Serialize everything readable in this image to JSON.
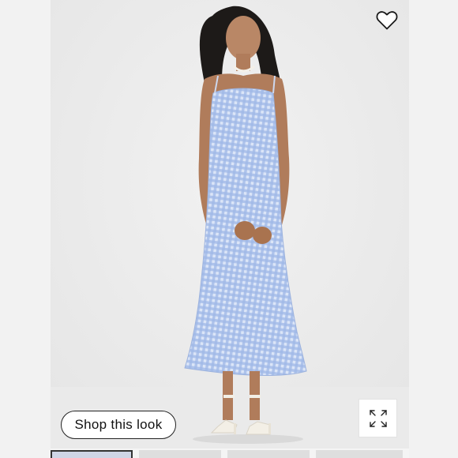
{
  "product": {
    "shop_look_label": "Shop this look"
  },
  "icons": {
    "favorite": "heart-icon",
    "fullscreen": "expand-icon"
  },
  "colors": {
    "dress": "#a9c0ea",
    "background": "#ececec",
    "button_border": "#222222"
  },
  "gallery": {
    "thumbnail_count": 4,
    "active_index": 0
  }
}
